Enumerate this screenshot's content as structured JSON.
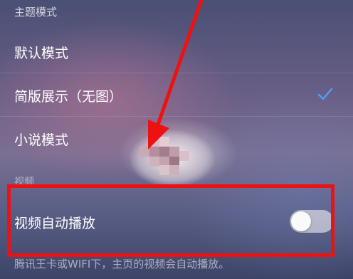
{
  "section_header": "主题模式",
  "theme_options": [
    {
      "label": "默认模式",
      "selected": false
    },
    {
      "label": "简版展示（无图）",
      "selected": true
    },
    {
      "label": "小说模式",
      "selected": false
    }
  ],
  "video_section_header": "视频",
  "autoplay": {
    "label": "视频自动播放",
    "on": false
  },
  "footer_text": "腾讯王卡或WIFI下，主页的视频会自动播放。",
  "colors": {
    "highlight": "#ee1111",
    "checkmark": "#4aa0ff"
  }
}
